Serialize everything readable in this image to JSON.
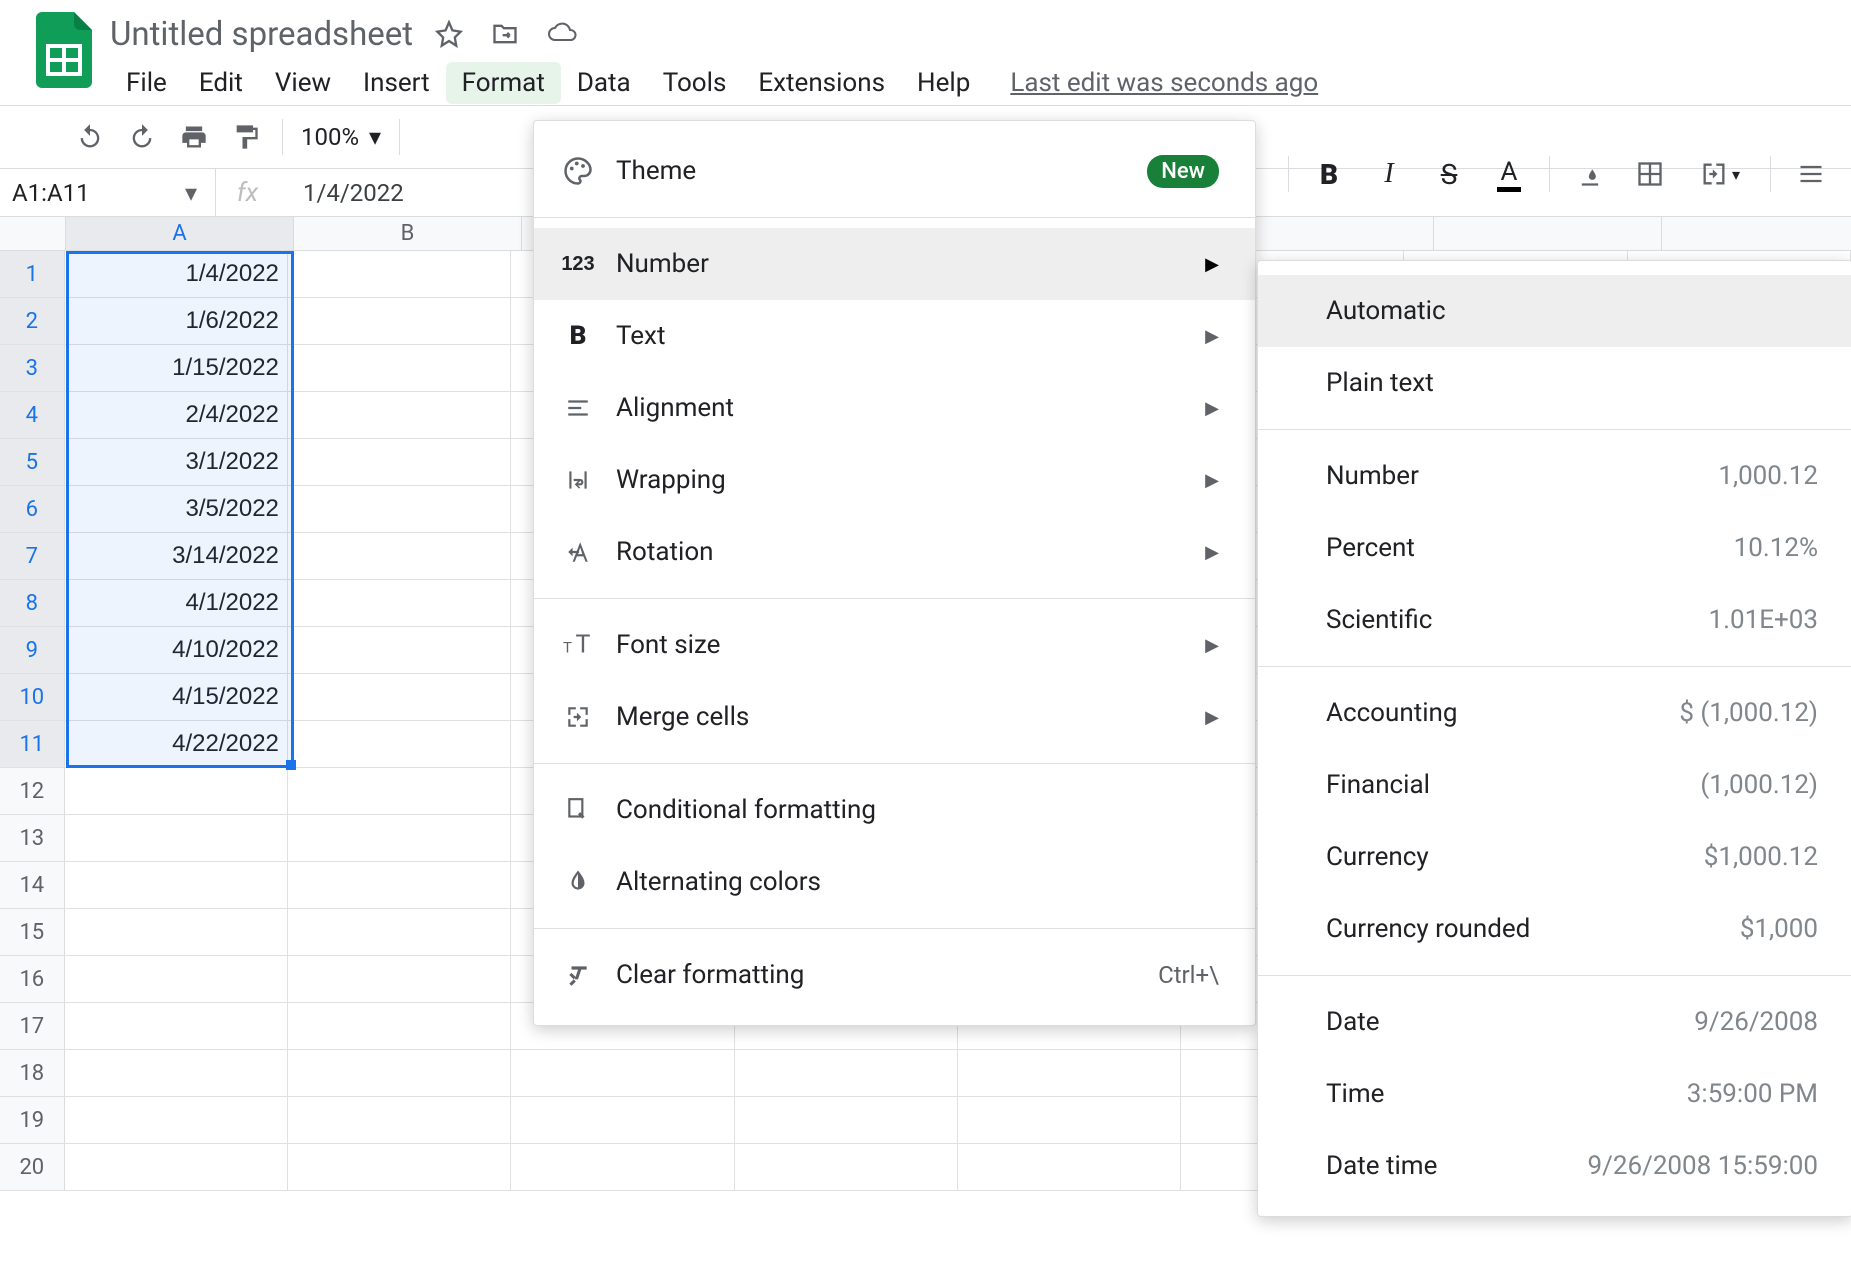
{
  "header": {
    "title": "Untitled spreadsheet",
    "last_edit": "Last edit was seconds ago"
  },
  "menubar": [
    "File",
    "Edit",
    "View",
    "Insert",
    "Format",
    "Data",
    "Tools",
    "Extensions",
    "Help"
  ],
  "toolbar": {
    "zoom": "100%"
  },
  "namebox": "A1:A11",
  "formula_value": "1/4/2022",
  "columns": [
    "A",
    "B"
  ],
  "rows": [
    {
      "n": "1",
      "a": "1/4/2022"
    },
    {
      "n": "2",
      "a": "1/6/2022"
    },
    {
      "n": "3",
      "a": "1/15/2022"
    },
    {
      "n": "4",
      "a": "2/4/2022"
    },
    {
      "n": "5",
      "a": "3/1/2022"
    },
    {
      "n": "6",
      "a": "3/5/2022"
    },
    {
      "n": "7",
      "a": "3/14/2022"
    },
    {
      "n": "8",
      "a": "4/1/2022"
    },
    {
      "n": "9",
      "a": "4/10/2022"
    },
    {
      "n": "10",
      "a": "4/15/2022"
    },
    {
      "n": "11",
      "a": "4/22/2022"
    },
    {
      "n": "12",
      "a": ""
    },
    {
      "n": "13",
      "a": ""
    },
    {
      "n": "14",
      "a": ""
    },
    {
      "n": "15",
      "a": ""
    },
    {
      "n": "16",
      "a": ""
    },
    {
      "n": "17",
      "a": ""
    },
    {
      "n": "18",
      "a": ""
    },
    {
      "n": "19",
      "a": ""
    },
    {
      "n": "20",
      "a": ""
    }
  ],
  "format_menu": {
    "theme": "Theme",
    "theme_badge": "New",
    "number": "Number",
    "text": "Text",
    "alignment": "Alignment",
    "wrapping": "Wrapping",
    "rotation": "Rotation",
    "font_size": "Font size",
    "merge_cells": "Merge cells",
    "conditional": "Conditional formatting",
    "alternating": "Alternating colors",
    "clear": "Clear formatting",
    "clear_shortcut": "Ctrl+\\"
  },
  "number_menu": {
    "automatic": "Automatic",
    "plain": "Plain text",
    "number": {
      "label": "Number",
      "sample": "1,000.12"
    },
    "percent": {
      "label": "Percent",
      "sample": "10.12%"
    },
    "scientific": {
      "label": "Scientific",
      "sample": "1.01E+03"
    },
    "accounting": {
      "label": "Accounting",
      "sample": "$ (1,000.12)"
    },
    "financial": {
      "label": "Financial",
      "sample": "(1,000.12)"
    },
    "currency": {
      "label": "Currency",
      "sample": "$1,000.12"
    },
    "currency_rounded": {
      "label": "Currency rounded",
      "sample": "$1,000"
    },
    "date": {
      "label": "Date",
      "sample": "9/26/2008"
    },
    "time": {
      "label": "Time",
      "sample": "3:59:00 PM"
    },
    "datetime": {
      "label": "Date time",
      "sample": "9/26/2008 15:59:00"
    }
  }
}
